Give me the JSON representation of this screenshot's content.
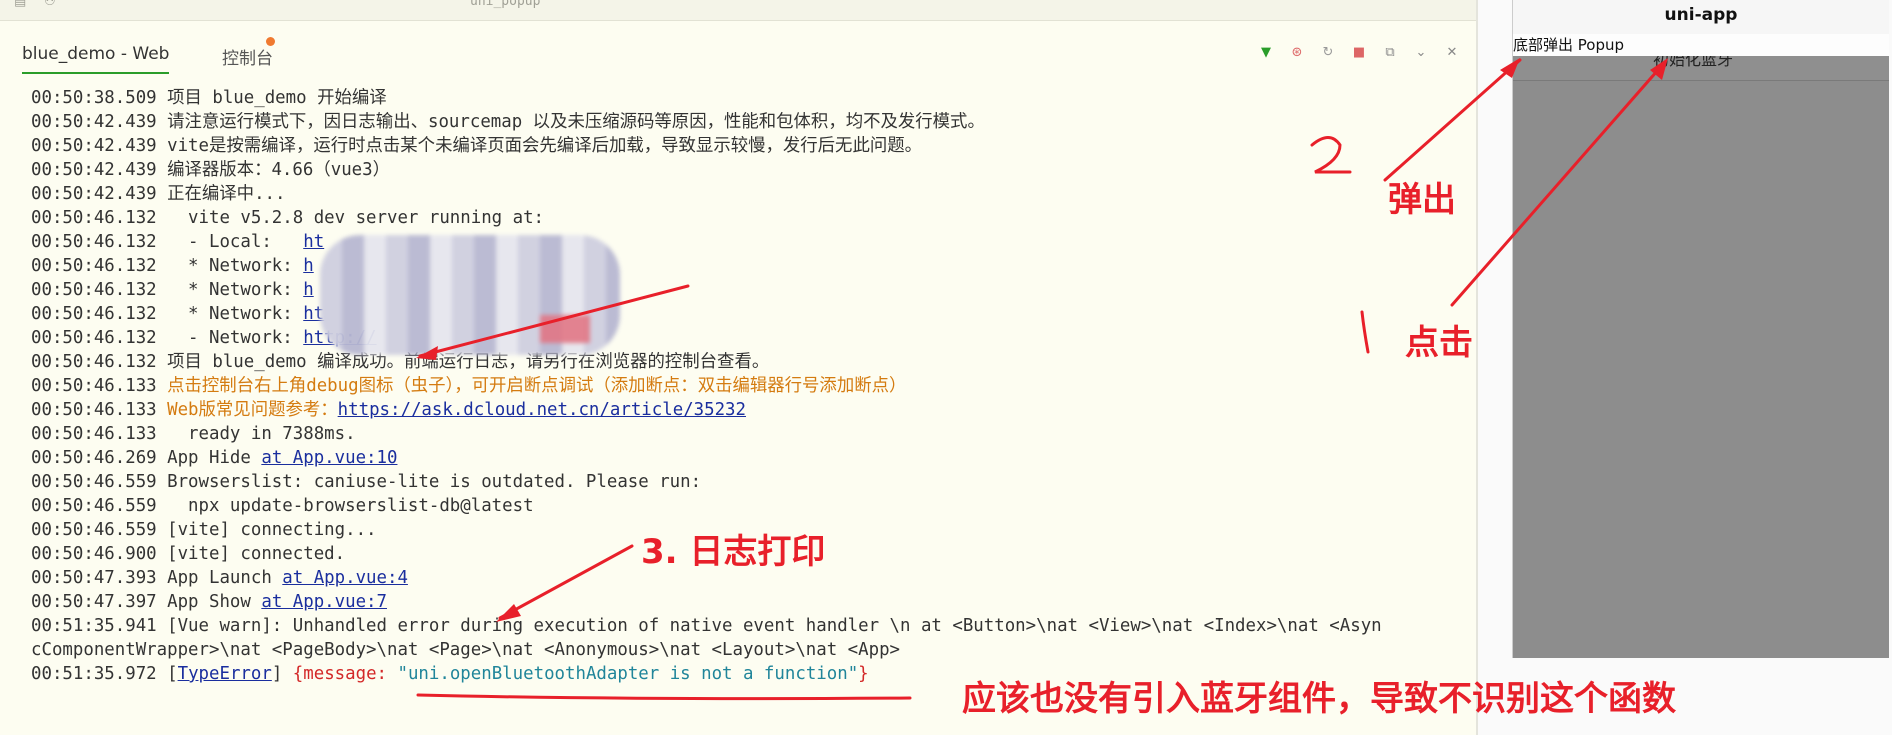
{
  "editor": {
    "topstrip_text": "uni_popup"
  },
  "tabs": [
    {
      "label": "blue_demo - Web"
    },
    {
      "label": "控制台"
    }
  ],
  "console": {
    "lines": [
      {
        "ts": "00:50:38.509",
        "parts": [
          {
            "t": " 项目 blue_demo 开始编译",
            "c": ""
          }
        ]
      },
      {
        "ts": "00:50:42.439",
        "parts": [
          {
            "t": " 请注意运行模式下，因日志输出、sourcemap 以及未压缩源码等原因，性能和包体积，均不及发行模式。",
            "c": ""
          }
        ]
      },
      {
        "ts": "00:50:42.439",
        "parts": [
          {
            "t": " vite是按需编译，运行时点击某个未编译页面会先编译后加载，导致显示较慢，发行后无此问题。",
            "c": ""
          }
        ]
      },
      {
        "ts": "00:50:42.439",
        "parts": [
          {
            "t": " 编译器版本：4.66（vue3）",
            "c": ""
          }
        ]
      },
      {
        "ts": "00:50:42.439",
        "parts": [
          {
            "t": " 正在编译中...",
            "c": ""
          }
        ]
      },
      {
        "ts": "00:50:46.132",
        "parts": [
          {
            "t": "   vite v5.2.8 dev server running at:",
            "c": ""
          }
        ]
      },
      {
        "ts": "00:50:46.132",
        "parts": [
          {
            "t": "   - Local:   ",
            "c": ""
          },
          {
            "t": "ht",
            "c": "link"
          }
        ]
      },
      {
        "ts": "00:50:46.132",
        "parts": [
          {
            "t": "   * Network: ",
            "c": ""
          },
          {
            "t": "h",
            "c": "link"
          }
        ]
      },
      {
        "ts": "00:50:46.132",
        "parts": [
          {
            "t": "   * Network: ",
            "c": ""
          },
          {
            "t": "h",
            "c": "link"
          }
        ]
      },
      {
        "ts": "00:50:46.132",
        "parts": [
          {
            "t": "   * Network: ",
            "c": ""
          },
          {
            "t": "ht",
            "c": "link"
          }
        ]
      },
      {
        "ts": "00:50:46.132",
        "parts": [
          {
            "t": "   - Network: ",
            "c": ""
          },
          {
            "t": "http://",
            "c": "link"
          }
        ]
      },
      {
        "ts": "00:50:46.132",
        "parts": [
          {
            "t": " 项目 blue_demo 编译成功。前端运行日志，请另行在浏览器的控制台查看。",
            "c": ""
          }
        ]
      },
      {
        "ts": "00:50:46.133",
        "parts": [
          {
            "t": " 点击控制台右上角debug图标（虫子），可开启断点调试（添加断点：双击编辑器行号添加断点）",
            "c": "orange"
          }
        ]
      },
      {
        "ts": "00:50:46.133",
        "parts": [
          {
            "t": " Web版常见问题参考：",
            "c": "orange"
          },
          {
            "t": "https://ask.dcloud.net.cn/article/35232",
            "c": "link"
          }
        ]
      },
      {
        "ts": "00:50:46.133",
        "parts": [
          {
            "t": "   ready in 7388ms.",
            "c": ""
          }
        ]
      },
      {
        "ts": "00:50:46.269",
        "parts": [
          {
            "t": " App Hide ",
            "c": ""
          },
          {
            "t": "at App.vue:10",
            "c": "link"
          }
        ]
      },
      {
        "ts": "00:50:46.559",
        "parts": [
          {
            "t": " Browserslist: caniuse-lite is outdated. Please run:",
            "c": ""
          }
        ]
      },
      {
        "ts": "00:50:46.559",
        "parts": [
          {
            "t": "   npx update-browserslist-db@latest",
            "c": ""
          }
        ]
      },
      {
        "ts": "00:50:46.559",
        "parts": [
          {
            "t": " [vite] connecting...",
            "c": ""
          }
        ]
      },
      {
        "ts": "00:50:46.900",
        "parts": [
          {
            "t": " [vite] connected.",
            "c": ""
          }
        ]
      },
      {
        "ts": "00:50:47.393",
        "parts": [
          {
            "t": " App Launch ",
            "c": ""
          },
          {
            "t": "at App.vue:4",
            "c": "link"
          }
        ]
      },
      {
        "ts": "00:50:47.397",
        "parts": [
          {
            "t": " App Show ",
            "c": ""
          },
          {
            "t": "at App.vue:7",
            "c": "link"
          }
        ]
      },
      {
        "ts": "00:51:35.941",
        "parts": [
          {
            "t": " [Vue warn]: Unhandled error during execution of native event handler \\n at <Button>\\nat <View>\\nat <Index>\\nat <Asyn",
            "c": ""
          }
        ]
      },
      {
        "ts": "",
        "parts": [
          {
            "t": "cComponentWrapper>\\nat <PageBody>\\nat <Page>\\nat <Anonymous>\\nat <Layout>\\nat <App>",
            "c": ""
          }
        ]
      },
      {
        "ts": "00:51:35.972",
        "parts": [
          {
            "t": " [",
            "c": ""
          },
          {
            "t": "TypeError",
            "c": "link"
          },
          {
            "t": "] ",
            "c": ""
          },
          {
            "t": "{message: ",
            "c": "red"
          },
          {
            "t": "\"uni.openBluetoothAdapter is not a function\"",
            "c": "teal"
          },
          {
            "t": "}",
            "c": "red"
          }
        ]
      }
    ]
  },
  "preview": {
    "title": "uni-app",
    "popup_label": "底部弹出 Popup",
    "button_label": "初始化蓝牙"
  },
  "annotations": {
    "num2": "2",
    "popup": "弹出",
    "num1": "1",
    "click": "点击",
    "log": "3. 日志打印",
    "note": "应该也没有引入蓝牙组件，导致不识别这个函数"
  },
  "colors": {
    "accent": "#2a9d2a",
    "annotation": "#e8202a",
    "link": "#1a2e9e",
    "warn": "#d47b10"
  }
}
